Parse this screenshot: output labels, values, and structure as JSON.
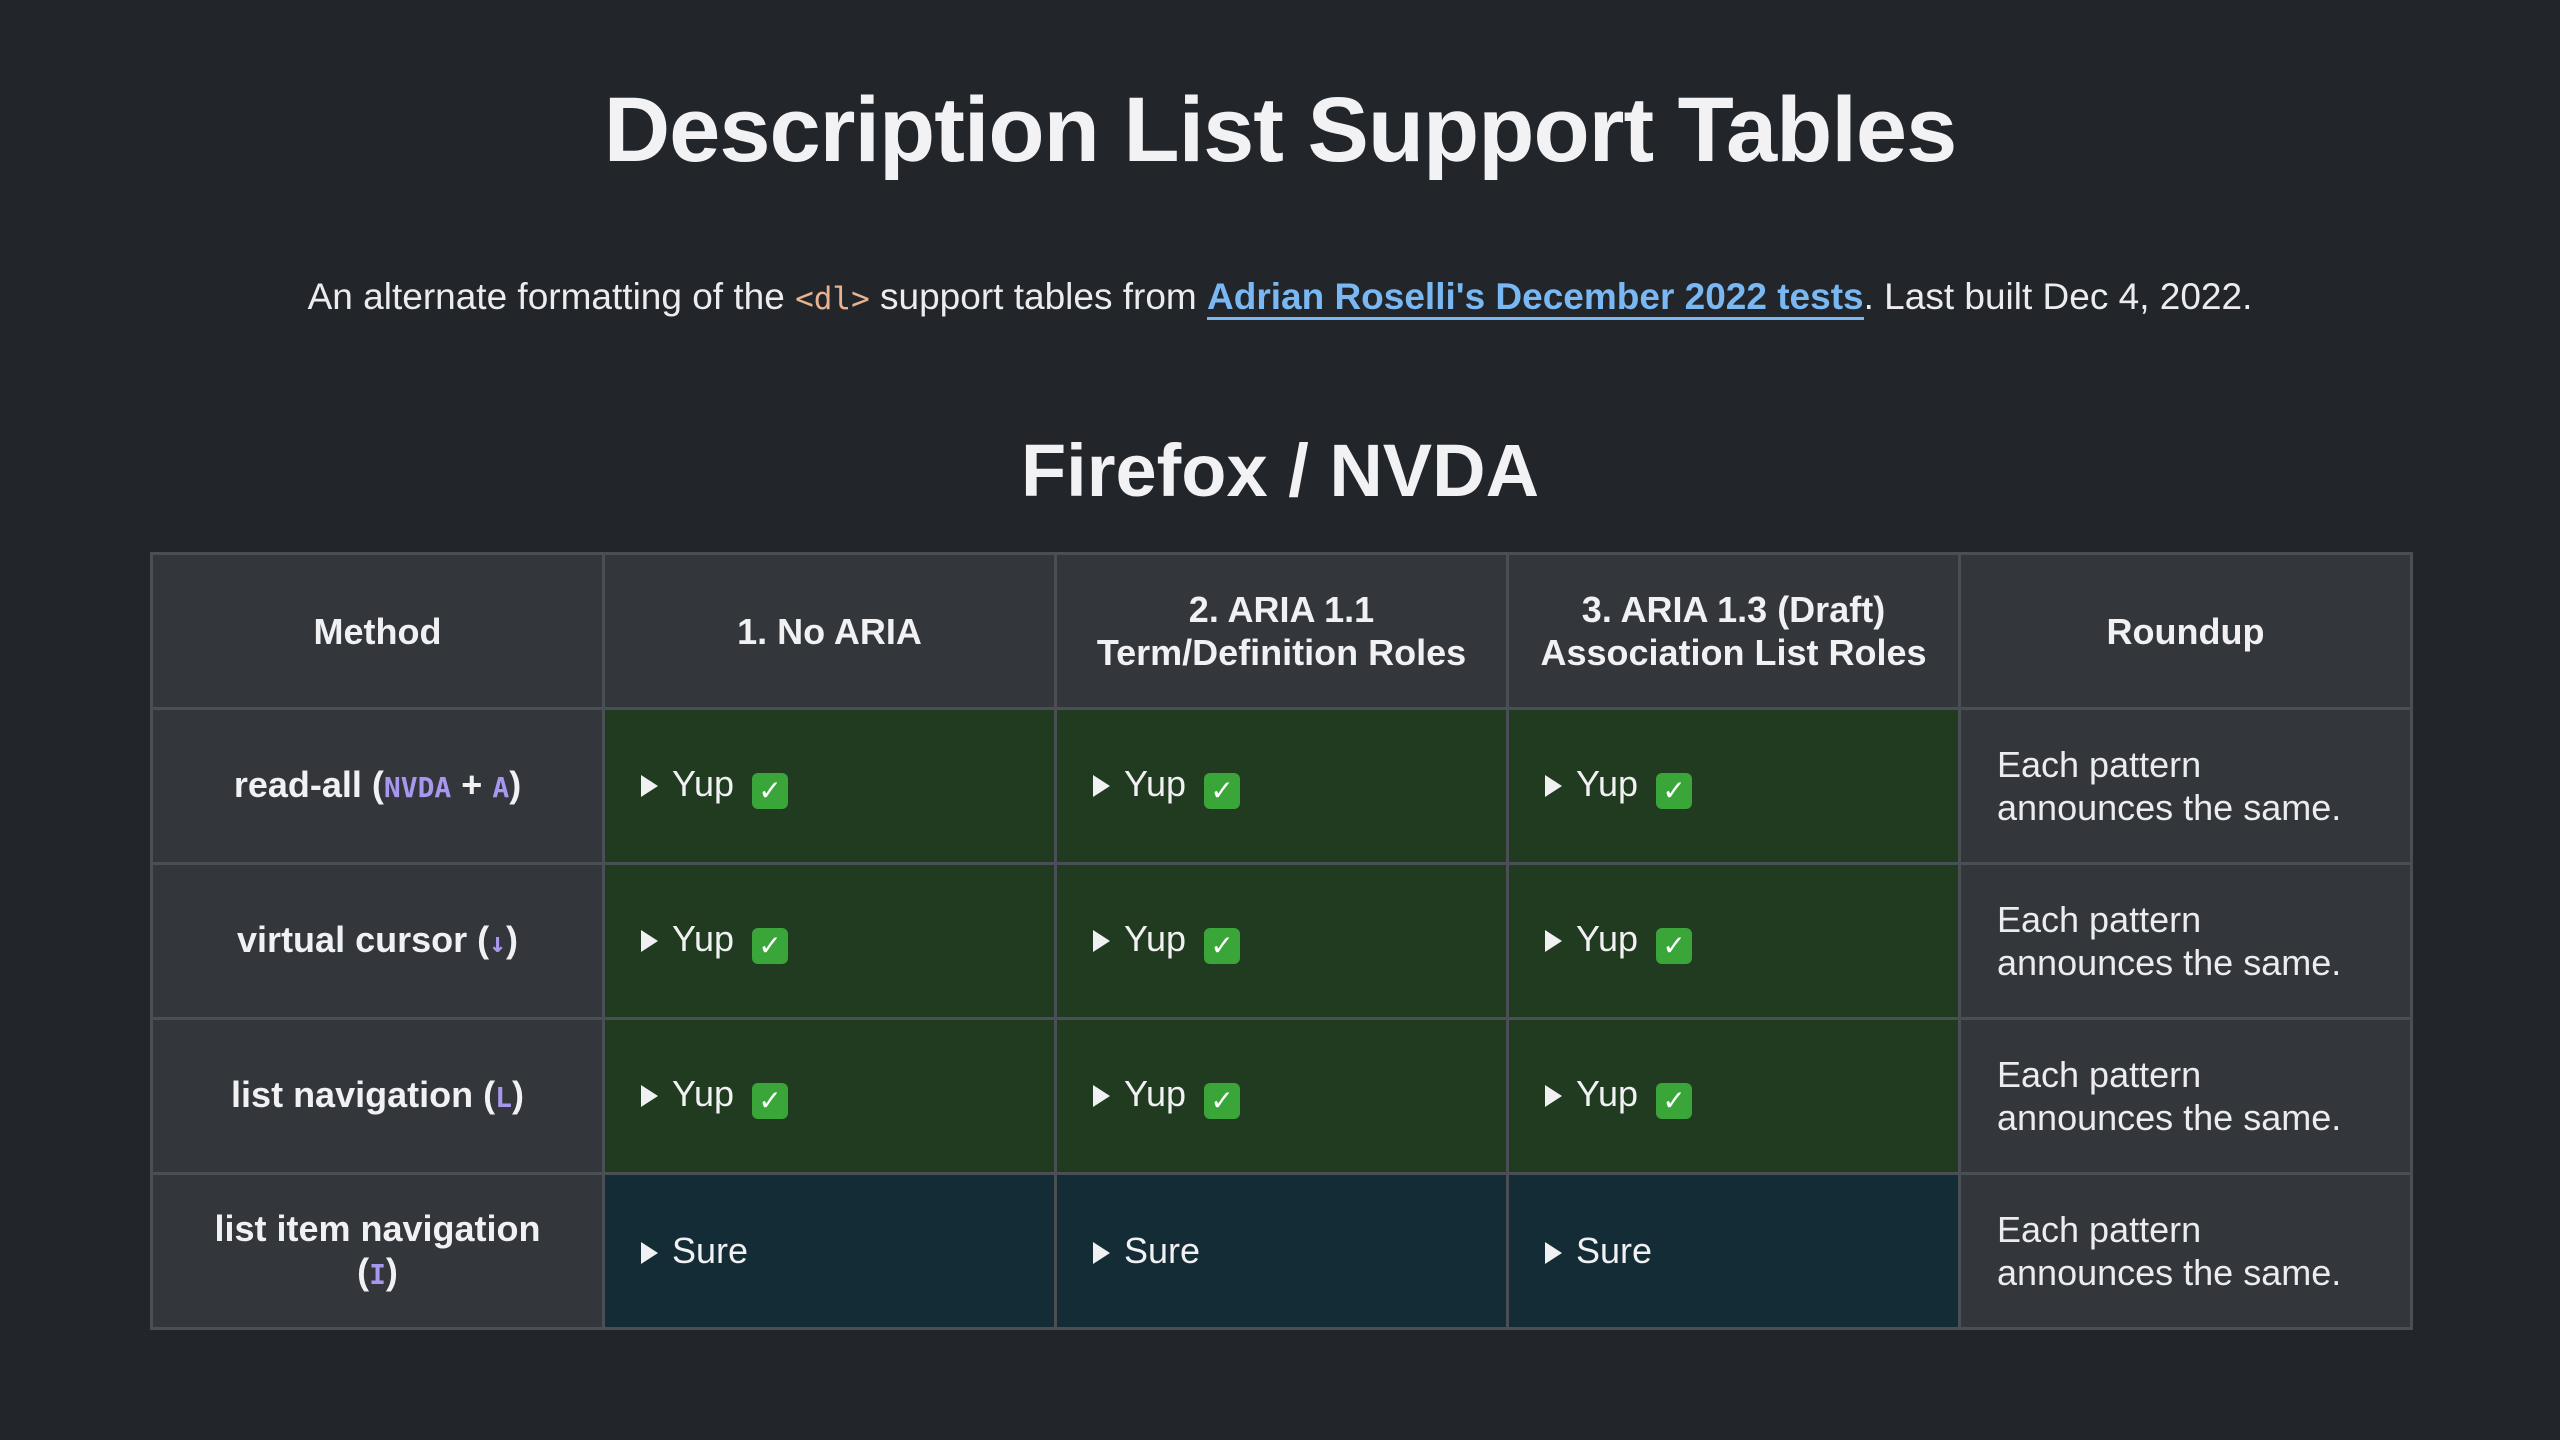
{
  "page": {
    "title": "Description List Support Tables",
    "intro": {
      "before_code": "An alternate formatting of the ",
      "code": "<dl>",
      "after_code": " support tables from ",
      "link_text": "Adrian Roselli's December 2022 tests",
      "after_link": ". Last built Dec 4, 2022."
    }
  },
  "section": {
    "title": "Firefox / NVDA"
  },
  "table": {
    "headers": {
      "method": "Method",
      "col1": "1. No ARIA",
      "col2_line1": "2. ARIA 1.1",
      "col2_line2": "Term/Definition Roles",
      "col3_line1": "3. ARIA 1.3 (Draft)",
      "col3_line2": "Association List Roles",
      "roundup": "Roundup"
    },
    "rows": [
      {
        "method": "read-all (",
        "key1": "NVDA",
        "plus": " + ",
        "key2": "A",
        "close": ")",
        "results": [
          "Yup",
          "Yup",
          "Yup"
        ],
        "check": "✓",
        "roundup": "Each pattern announces the same."
      },
      {
        "method": "virtual cursor (",
        "key": "↓",
        "close": ")",
        "results": [
          "Yup",
          "Yup",
          "Yup"
        ],
        "check": "✓",
        "roundup": "Each pattern announces the same."
      },
      {
        "method": "list navigation (",
        "key": "L",
        "close": ")",
        "results": [
          "Yup",
          "Yup",
          "Yup"
        ],
        "check": "✓",
        "roundup": "Each pattern announces the same."
      },
      {
        "method": "list item navigation",
        "open": "(",
        "key": "I",
        "close": ")",
        "results": [
          "Sure",
          "Sure",
          "Sure"
        ],
        "roundup": "Each pattern announces the same."
      }
    ]
  },
  "colors": {
    "background": "#22252a",
    "header_cell": "#33363b",
    "yup_cell": "#213b20",
    "sure_cell": "#132c35",
    "link": "#79b8f2",
    "code": "#e7b28e",
    "kbd": "#a897ee",
    "check": "#3aa63a"
  }
}
